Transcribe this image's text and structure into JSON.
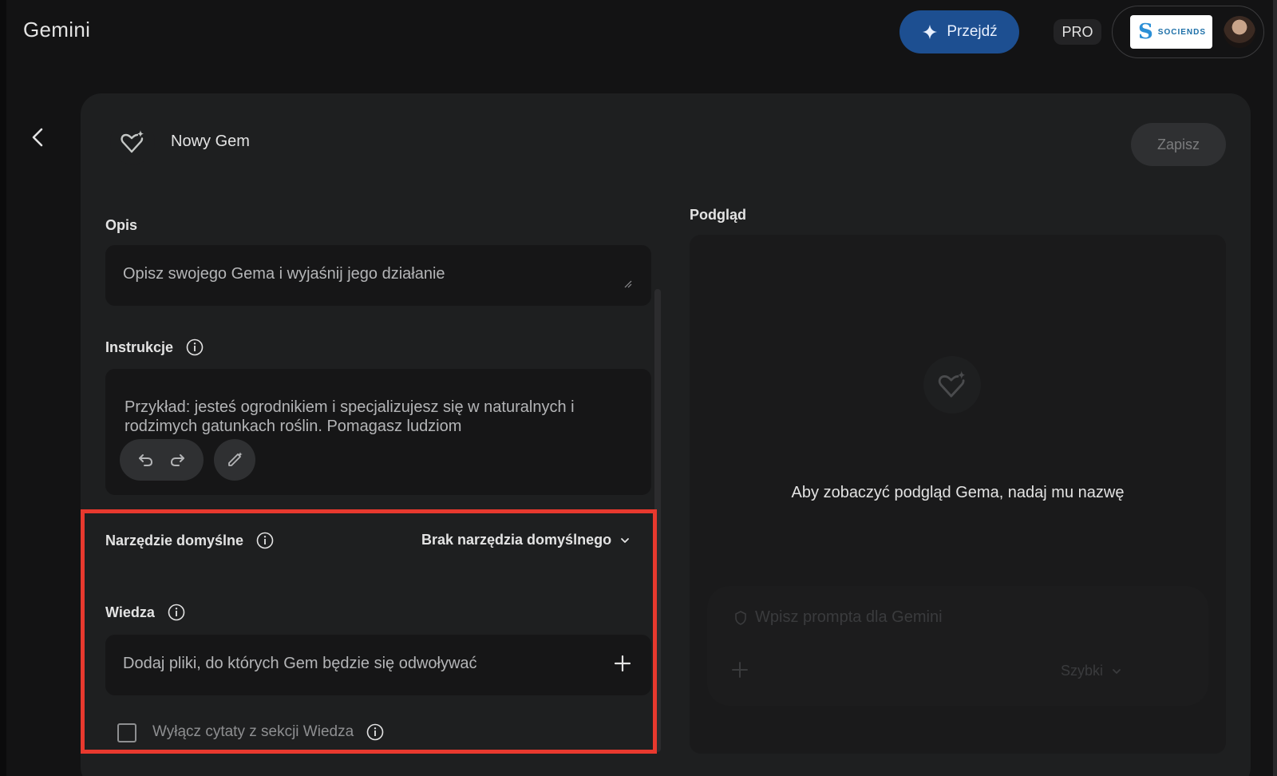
{
  "app": {
    "title": "Gemini"
  },
  "header": {
    "go_label": "Przejdź",
    "pro_label": "PRO",
    "org_logo_text": "SOCIENDS"
  },
  "editor": {
    "gem_name": "Nowy Gem",
    "save_label": "Zapisz",
    "description": {
      "label": "Opis",
      "placeholder": "Opisz swojego Gema i wyjaśnij jego działanie"
    },
    "instructions": {
      "label": "Instrukcje",
      "placeholder": "Przykład: jesteś ogrodnikiem i specjalizujesz się w naturalnych i rodzimych gatunkach roślin. Pomagasz ludziom"
    },
    "default_tool": {
      "label": "Narzędzie domyślne",
      "value": "Brak narzędzia domyślnego"
    },
    "knowledge": {
      "label": "Wiedza",
      "placeholder": "Dodaj pliki, do których Gem będzie się odwoływać"
    },
    "disable_citations": {
      "label": "Wyłącz cytaty z sekcji Wiedza",
      "checked": false
    }
  },
  "preview": {
    "label": "Podgląd",
    "message": "Aby zobaczyć podgląd Gema, nadaj mu nazwę",
    "prompt_placeholder": "Wpisz prompta dla Gemini",
    "mode_label": "Szybki"
  },
  "colors": {
    "accent_button": "#1d4f91",
    "highlight_border": "#e8392e",
    "background": "#131314",
    "card": "#1e1f20"
  }
}
